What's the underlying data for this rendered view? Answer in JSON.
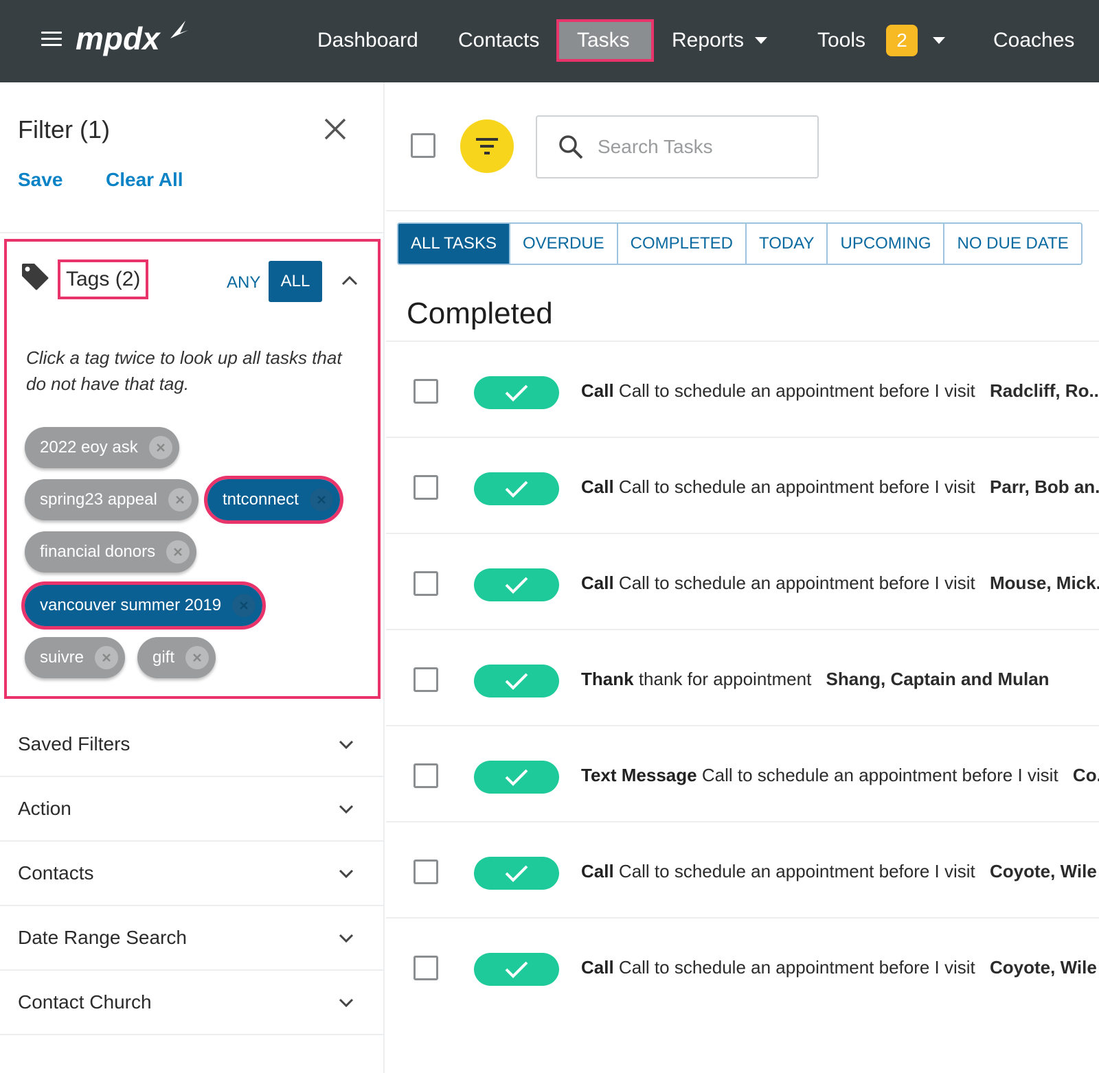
{
  "nav": {
    "logo": "mpdx",
    "items": [
      "Dashboard",
      "Contacts",
      "Tasks",
      "Reports",
      "Tools",
      "Coaches"
    ],
    "active": "Tasks",
    "tools_badge": "2"
  },
  "sidebar": {
    "title": "Filter (1)",
    "save_label": "Save",
    "clear_label": "Clear All",
    "tags": {
      "title": "Tags (2)",
      "any_label": "ANY",
      "all_label": "ALL",
      "hint": "Click a tag twice to look up all tasks that do not have that tag.",
      "chips": [
        {
          "label": "2022 eoy ask",
          "selected": false
        },
        {
          "label": "spring23 appeal",
          "selected": false
        },
        {
          "label": "tntconnect",
          "selected": true
        },
        {
          "label": "financial donors",
          "selected": false
        },
        {
          "label": "vancouver summer 2019",
          "selected": true
        },
        {
          "label": "suivre",
          "selected": false
        },
        {
          "label": "gift",
          "selected": false
        }
      ]
    },
    "sections": [
      "Saved Filters",
      "Action",
      "Contacts",
      "Date Range Search",
      "Contact Church"
    ]
  },
  "main": {
    "search_placeholder": "Search Tasks",
    "tabs": [
      "ALL TASKS",
      "OVERDUE",
      "COMPLETED",
      "TODAY",
      "UPCOMING",
      "NO DUE DATE"
    ],
    "active_tab": "ALL TASKS",
    "section_title": "Completed",
    "tasks": [
      {
        "type": "Call",
        "subject": "Call to schedule an appointment before I visit",
        "contact": "Radcliff, Ro..."
      },
      {
        "type": "Call",
        "subject": "Call to schedule an appointment before I visit",
        "contact": "Parr, Bob an..."
      },
      {
        "type": "Call",
        "subject": "Call to schedule an appointment before I visit",
        "contact": "Mouse, Mick..."
      },
      {
        "type": "Thank",
        "subject": "thank for appointment",
        "contact": "Shang, Captain and Mulan"
      },
      {
        "type": "Text Message",
        "subject": "Call to schedule an appointment before I visit",
        "contact": "Co..."
      },
      {
        "type": "Call",
        "subject": "Call to schedule an appointment before I visit",
        "contact": "Coyote, Wile"
      },
      {
        "type": "Call",
        "subject": "Call to schedule an appointment before I visit",
        "contact": "Coyote, Wile"
      }
    ]
  },
  "colors": {
    "nav_bg": "#383f43",
    "accent_blue": "#0a5f93",
    "link_blue": "#0a83c6",
    "highlight_pink": "#e8336b",
    "complete_green": "#1ec99a",
    "filter_yellow": "#f7d51d",
    "badge_orange": "#f7b924"
  }
}
